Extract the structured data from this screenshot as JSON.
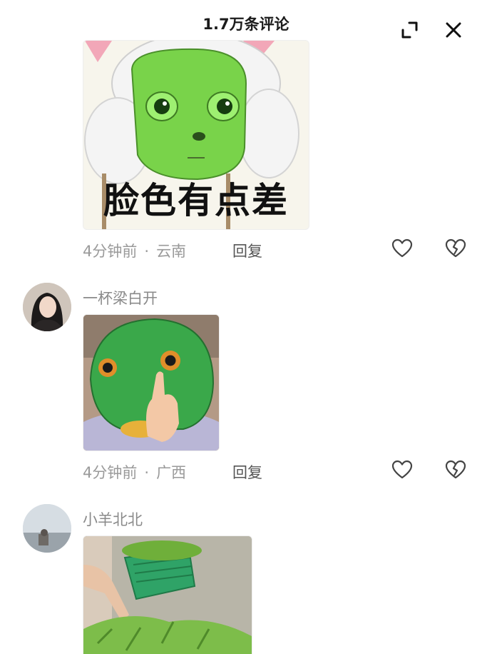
{
  "header": {
    "title": "1.7万条评论",
    "icons": [
      "expand-icon",
      "close-icon"
    ]
  },
  "comments": [
    {
      "username": "",
      "image": {
        "name": "green-face-sheep-meme",
        "caption": "脸色有点差",
        "colors": {
          "face": "#79d34a",
          "hair": "#f4f4f4",
          "bg": "#f7f5ec"
        }
      },
      "time": "4分钟前",
      "location": "云南",
      "reply_label": "回复"
    },
    {
      "username": "一杯梁白开",
      "image": {
        "name": "green-fish-mask-photo",
        "colors": {
          "mask": "#3aa84a",
          "hand": "#f3c8a6",
          "bg": "#b49a86"
        }
      },
      "time": "4分钟前",
      "location": "广西",
      "reply_label": "回复"
    },
    {
      "username": "小羊北北",
      "image": {
        "name": "vegetables-basket-photo",
        "colors": {
          "basket": "#2fa367",
          "leaves": "#7dbd4a",
          "ground": "#b8b5a8"
        }
      }
    }
  ],
  "colors": {
    "text_primary": "#1b1b1b",
    "text_secondary": "#8a8a8a",
    "reply": "#555555"
  }
}
